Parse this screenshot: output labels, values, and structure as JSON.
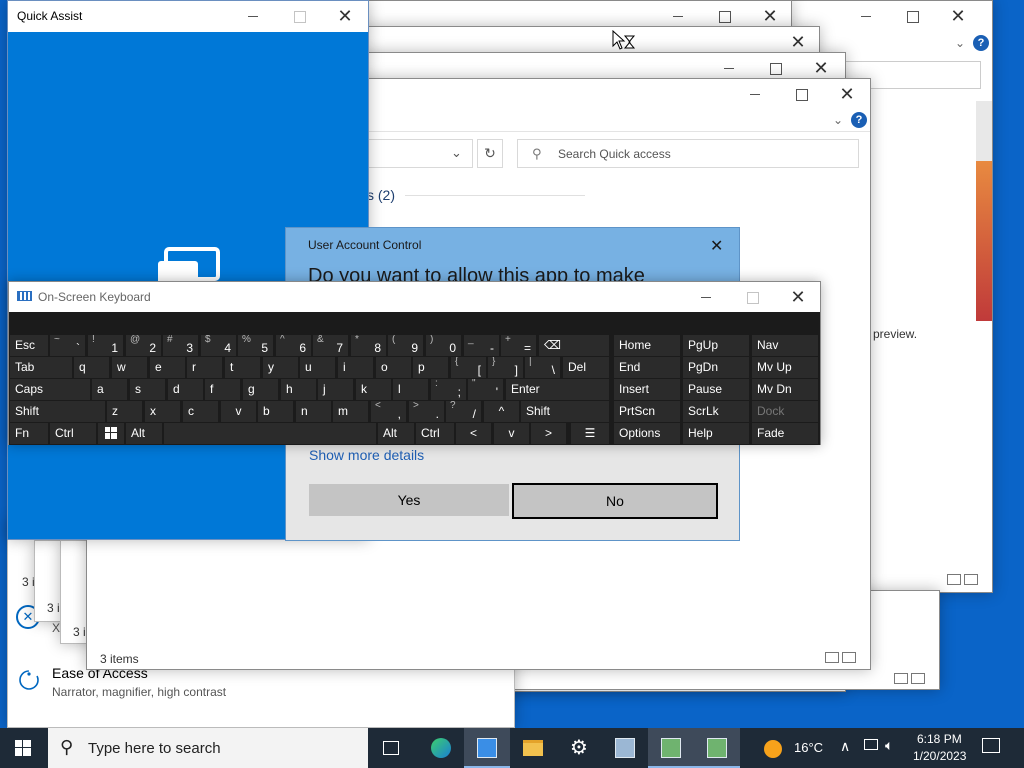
{
  "qa": {
    "title": "Quick Assist"
  },
  "explorer": {
    "search_placeholder": "Search Quick access",
    "group_title": "s (2)",
    "status": "3 items",
    "status_short": "3 i",
    "preview_text": "preview."
  },
  "settings": {
    "ease_title": "Ease of Access",
    "ease_sub": "Narrator, magnifier, high contrast",
    "x_letter": "X"
  },
  "uac": {
    "app_title": "User Account Control",
    "question": "Do you want to allow this app to make",
    "more_details": "Show more details",
    "yes": "Yes",
    "no": "No"
  },
  "osk": {
    "title": "On-Screen Keyboard",
    "rows": [
      [
        {
          "m": "Esc"
        },
        {
          "s": "~",
          "m": "`"
        },
        {
          "s": "!",
          "m": "1"
        },
        {
          "s": "@",
          "m": "2"
        },
        {
          "s": "#",
          "m": "3"
        },
        {
          "s": "$",
          "m": "4"
        },
        {
          "s": "%",
          "m": "5"
        },
        {
          "s": "^",
          "m": "6"
        },
        {
          "s": "&",
          "m": "7"
        },
        {
          "s": "*",
          "m": "8"
        },
        {
          "s": "(",
          "m": "9"
        },
        {
          "s": ")",
          "m": "0"
        },
        {
          "s": "_",
          "m": "-"
        },
        {
          "s": "+",
          "m": "="
        },
        {
          "m": "⌫"
        }
      ],
      [
        {
          "m": "Tab"
        },
        {
          "m": "q"
        },
        {
          "m": "w"
        },
        {
          "m": "e"
        },
        {
          "m": "r"
        },
        {
          "m": "t"
        },
        {
          "m": "y"
        },
        {
          "m": "u"
        },
        {
          "m": "i"
        },
        {
          "m": "o"
        },
        {
          "m": "p"
        },
        {
          "s": "{",
          "m": "["
        },
        {
          "s": "}",
          "m": "]"
        },
        {
          "s": "|",
          "m": "\\"
        },
        {
          "m": "Del"
        }
      ],
      [
        {
          "m": "Caps"
        },
        {
          "m": "a"
        },
        {
          "m": "s"
        },
        {
          "m": "d"
        },
        {
          "m": "f"
        },
        {
          "m": "g"
        },
        {
          "m": "h"
        },
        {
          "m": "j"
        },
        {
          "m": "k"
        },
        {
          "m": "l"
        },
        {
          "s": ":",
          "m": ";"
        },
        {
          "s": "\"",
          "m": "'"
        },
        {
          "m": "Enter"
        }
      ],
      [
        {
          "m": "Shift"
        },
        {
          "m": "z"
        },
        {
          "m": "x"
        },
        {
          "m": "c"
        },
        {
          "m": "v"
        },
        {
          "m": "b"
        },
        {
          "m": "n"
        },
        {
          "m": "m"
        },
        {
          "s": "<",
          "m": ","
        },
        {
          "s": ">",
          "m": "."
        },
        {
          "s": "?",
          "m": "/"
        },
        {
          "m": "^"
        },
        {
          "m": "Shift"
        }
      ],
      [
        {
          "m": "Fn"
        },
        {
          "m": "Ctrl"
        },
        {
          "m": "win-logo"
        },
        {
          "m": "Alt"
        },
        {
          "m": ""
        },
        {
          "m": "Alt"
        },
        {
          "m": "Ctrl"
        },
        {
          "m": "<"
        },
        {
          "m": "v"
        },
        {
          "m": ">"
        },
        {
          "m": "menu"
        }
      ]
    ],
    "nav_keys": [
      [
        "Home",
        "PgUp",
        "Nav"
      ],
      [
        "End",
        "PgDn",
        "Mv Up"
      ],
      [
        "Insert",
        "Pause",
        "Mv Dn"
      ],
      [
        "PrtScn",
        "ScrLk",
        "Dock"
      ],
      [
        "Options",
        "Help",
        "Fade"
      ]
    ]
  },
  "taskbar": {
    "search_placeholder": "Type here to search",
    "weather": "16°C",
    "time": "6:18 PM",
    "date": "1/20/2023",
    "icons": [
      "task-view-icon",
      "edge-icon",
      "remote-desktop-icon",
      "file-explorer-icon",
      "settings-gear-icon",
      "network-computer-icon",
      "quick-assist-icon",
      "quick-assist-icon-2"
    ]
  }
}
